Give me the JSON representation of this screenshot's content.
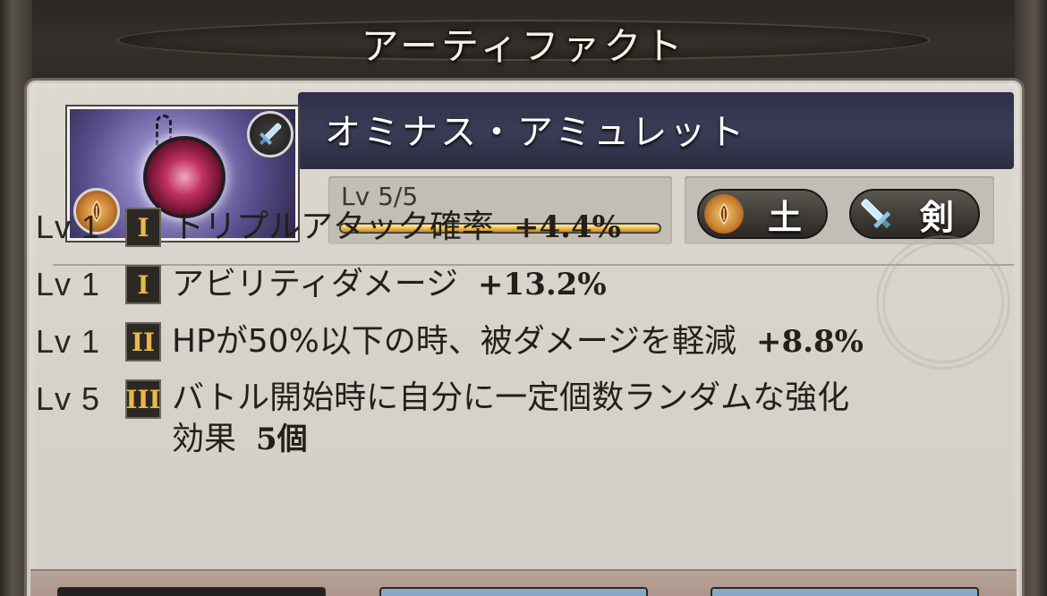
{
  "header": {
    "title": "アーティファクト"
  },
  "artifact": {
    "name": "オミナス・アミュレット",
    "level_label": "Lv 5/5",
    "level_progress": 1.0,
    "attribute_label": "土",
    "weapon_label": "剣"
  },
  "skills": [
    {
      "level": "Lv 1",
      "tier": "I",
      "text": "トリプルアタック確率",
      "value": "+4.4%"
    },
    {
      "level": "Lv 1",
      "tier": "I",
      "text": "アビリティダメージ",
      "value": "+13.2%"
    },
    {
      "level": "Lv 1",
      "tier": "II",
      "text": "HPが50%以下の時、被ダメージを軽減",
      "value": "+8.8%"
    },
    {
      "level": "Lv 5",
      "tier": "III",
      "text_line1": "バトル開始時に自分に一定個数ランダムな強化",
      "text_line2": "効果",
      "value": "5個"
    }
  ],
  "icons": {
    "weapon_icon": "sword-icon",
    "attribute_icon": "earth-element-icon"
  },
  "colors": {
    "title_band": "#2f3048",
    "level_bar": "#f0c04a",
    "attribute": "#c67c2c",
    "tier_gold": "#e8b94a"
  }
}
